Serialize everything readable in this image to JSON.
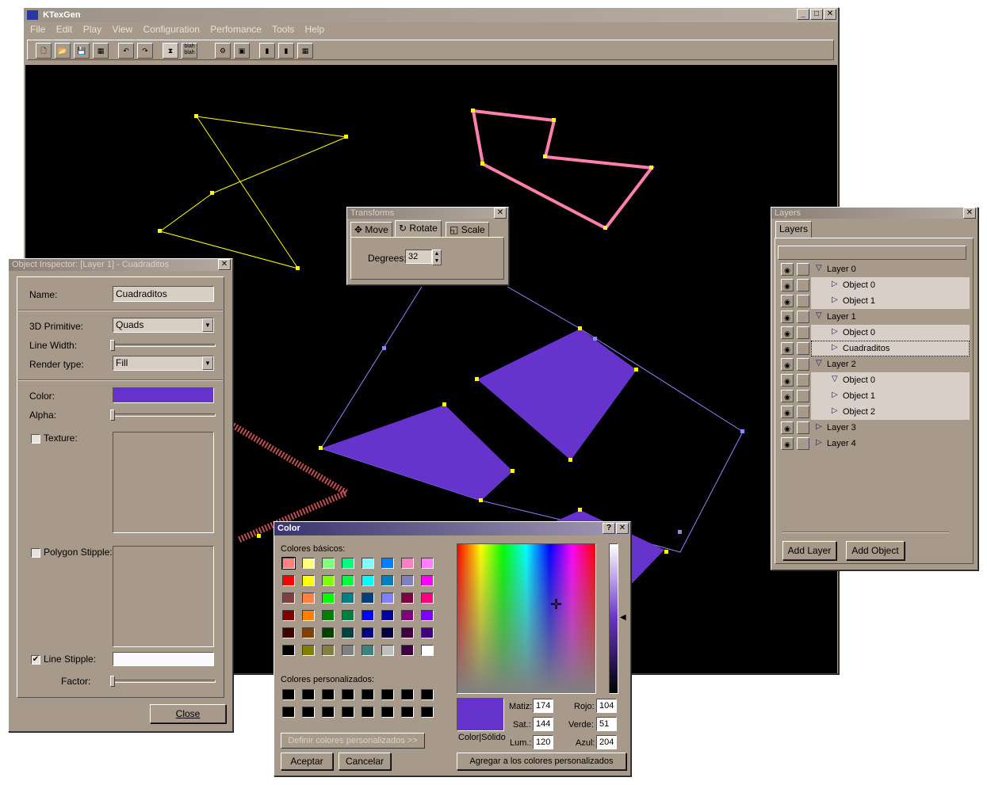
{
  "main": {
    "title": "KTexGen",
    "menu": [
      "File",
      "Edit",
      "Play",
      "View",
      "Configuration",
      "Perfomance",
      "Tools",
      "Help"
    ],
    "toolbar_text": {
      "blah": "blah blah"
    }
  },
  "transforms": {
    "title": "Transforms",
    "tabs": [
      "Move",
      "Rotate",
      "Scale"
    ],
    "degrees_label": "Degrees:",
    "degrees_value": "32"
  },
  "layers": {
    "title": "Layers",
    "tab": "Layers",
    "rows": [
      {
        "label": "Layer 0",
        "indent": 0,
        "expanded": true,
        "highlight": false
      },
      {
        "label": "Object 0",
        "indent": 1,
        "expanded": false,
        "highlight": true
      },
      {
        "label": "Object 1",
        "indent": 1,
        "expanded": false,
        "highlight": true
      },
      {
        "label": "Layer 1",
        "indent": 0,
        "expanded": true,
        "highlight": false
      },
      {
        "label": "Object 0",
        "indent": 1,
        "expanded": false,
        "highlight": true
      },
      {
        "label": "Cuadraditos",
        "indent": 1,
        "expanded": false,
        "highlight": true,
        "selected": true
      },
      {
        "label": "Layer 2",
        "indent": 0,
        "expanded": true,
        "highlight": false
      },
      {
        "label": "Object 0",
        "indent": 1,
        "expanded": true,
        "highlight": true
      },
      {
        "label": "Object 1",
        "indent": 1,
        "expanded": false,
        "highlight": true
      },
      {
        "label": "Object 2",
        "indent": 1,
        "expanded": false,
        "highlight": true
      },
      {
        "label": "Layer 3",
        "indent": 0,
        "expanded": false,
        "highlight": false
      },
      {
        "label": "Layer 4",
        "indent": 0,
        "expanded": false,
        "highlight": false
      }
    ],
    "add_layer": "Add Layer",
    "add_object": "Add Object"
  },
  "inspector": {
    "title": "Object Inspector: [Layer 1] - Cuadraditos",
    "name_label": "Name:",
    "name_value": "Cuadraditos",
    "primitive_label": "3D Primitive:",
    "primitive_value": "Quads",
    "line_width_label": "Line Width:",
    "line_width_level": 0,
    "render_label": "Render type:",
    "render_value": "Fill",
    "color_label": "Color:",
    "color_value": "#6633cc",
    "alpha_label": "Alpha:",
    "alpha_level": 0,
    "texture_label": "Texture:",
    "texture_checked": false,
    "stipple_label": "Polygon Stipple:",
    "stipple_checked": false,
    "line_stipple_label": "Line Stipple:",
    "line_stipple_checked": true,
    "factor_label": "Factor:",
    "factor_level": 0,
    "close": "Close"
  },
  "color_dialog": {
    "title": "Color",
    "basic_label": "Colores básicos:",
    "basic_colors": [
      "#ff8080",
      "#ffff80",
      "#80ff80",
      "#00ff80",
      "#80ffff",
      "#0080ff",
      "#ff80c0",
      "#ff80ff",
      "#ff0000",
      "#ffff00",
      "#80ff00",
      "#00ff40",
      "#00ffff",
      "#0080c0",
      "#8080c0",
      "#ff00ff",
      "#804040",
      "#ff8040",
      "#00ff00",
      "#008080",
      "#004080",
      "#8080ff",
      "#800040",
      "#ff0080",
      "#800000",
      "#ff8000",
      "#008000",
      "#008040",
      "#0000ff",
      "#0000a0",
      "#800080",
      "#8000ff",
      "#400000",
      "#804000",
      "#004000",
      "#004040",
      "#000080",
      "#000040",
      "#400040",
      "#400080",
      "#000000",
      "#808000",
      "#808040",
      "#808080",
      "#408080",
      "#c0c0c0",
      "#400040",
      "#ffffff"
    ],
    "custom_label": "Colores personalizados:",
    "define_button": "Definir colores personalizados >>",
    "accept": "Aceptar",
    "cancel": "Cancelar",
    "add_custom": "Agregar a los colores personalizados",
    "solid_label": "Color|Sólido",
    "hue_label": "Matiz:",
    "hue": "174",
    "sat_label": "Sat.:",
    "sat": "144",
    "lum_label": "Lum.:",
    "lum": "120",
    "red_label": "Rojo:",
    "red": "104",
    "green_label": "Verde:",
    "green": "51",
    "blue_label": "Azul:",
    "blue": "204",
    "help": "?",
    "close": "✕"
  }
}
